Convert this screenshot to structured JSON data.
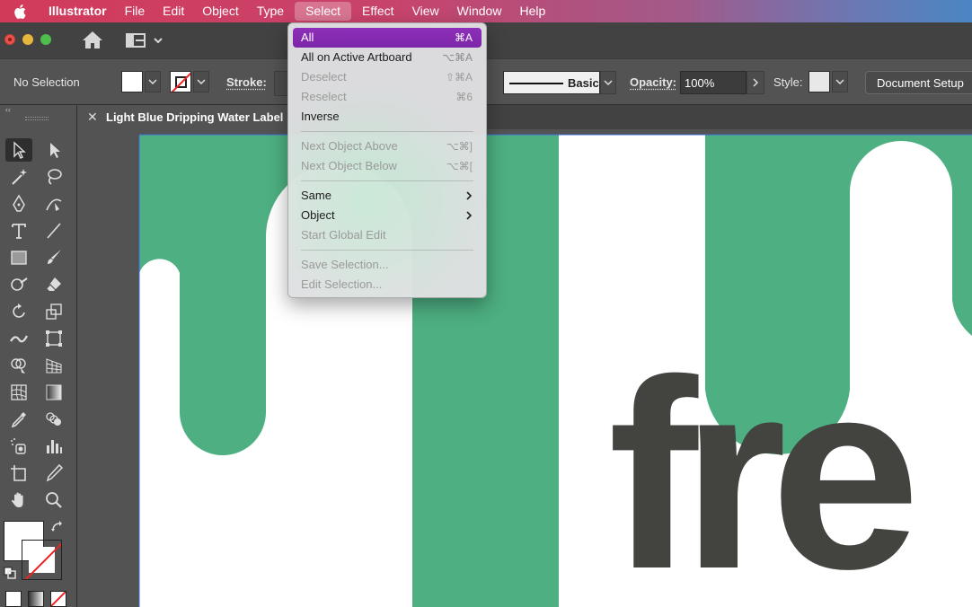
{
  "menubar": {
    "app_name": "Illustrator",
    "items": [
      "File",
      "Edit",
      "Object",
      "Type",
      "Select",
      "Effect",
      "View",
      "Window",
      "Help"
    ],
    "active_item": "Select"
  },
  "control_bar": {
    "selection_status": "No Selection",
    "stroke_label": "Stroke:",
    "brush_name": "Basic",
    "opacity_label": "Opacity:",
    "opacity_value": "100%",
    "style_label": "Style:",
    "document_setup_label": "Document Setup"
  },
  "document": {
    "tab_title": "Light Blue Dripping Water Label",
    "artwork_text": "fre"
  },
  "colors": {
    "artwork_green": "#4daf82",
    "artwork_text": "#434340",
    "menu_highlight": "#8a2fba"
  },
  "select_menu": {
    "items": [
      {
        "label": "All",
        "shortcut": "⌘A",
        "state": "highlighted"
      },
      {
        "label": "All on Active Artboard",
        "shortcut": "⌥⌘A",
        "state": "enabled"
      },
      {
        "label": "Deselect",
        "shortcut": "⇧⌘A",
        "state": "disabled"
      },
      {
        "label": "Reselect",
        "shortcut": "⌘6",
        "state": "disabled"
      },
      {
        "label": "Inverse",
        "shortcut": "",
        "state": "enabled"
      },
      {
        "label": "Next Object Above",
        "shortcut": "⌥⌘]",
        "state": "disabled"
      },
      {
        "label": "Next Object Below",
        "shortcut": "⌥⌘[",
        "state": "disabled"
      },
      {
        "label": "Same",
        "shortcut": "",
        "state": "enabled",
        "submenu": true
      },
      {
        "label": "Object",
        "shortcut": "",
        "state": "enabled",
        "submenu": true
      },
      {
        "label": "Start Global Edit",
        "shortcut": "",
        "state": "disabled"
      },
      {
        "label": "Save Selection...",
        "shortcut": "",
        "state": "disabled"
      },
      {
        "label": "Edit Selection...",
        "shortcut": "",
        "state": "disabled"
      }
    ]
  },
  "icons": {
    "apple": "apple-logo-icon",
    "home": "home-icon",
    "workspace": "workspace-switcher-icon",
    "submenu": "chevron-right-icon"
  }
}
